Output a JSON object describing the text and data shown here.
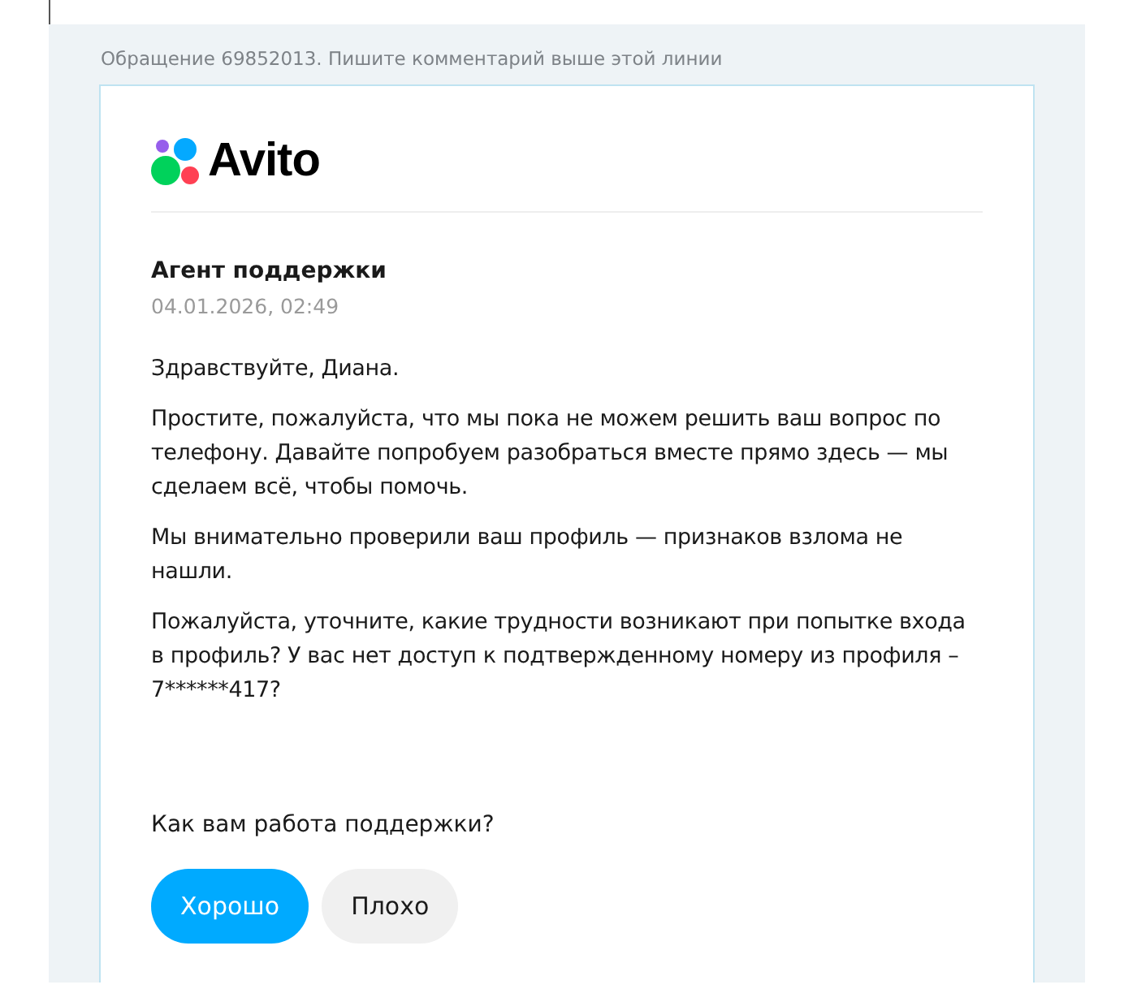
{
  "header_note": "Обращение 69852013. Пишите комментарий выше этой линии",
  "logo": {
    "text": "Avito"
  },
  "message": {
    "author": "Агент поддержки",
    "date": "04.01.2026, 02:49",
    "paragraphs": [
      "Здравствуйте, Диана.",
      "Простите, пожалуйста, что мы пока не можем решить ваш вопрос по телефону. Давайте попробуем разобраться вместе прямо здесь — мы сделаем всё, чтобы помочь.",
      "Мы внимательно проверили ваш профиль — признаков взлома не нашли.",
      "Пожалуйста, уточните, какие трудности возникают при попытке входа в профиль? У вас нет доступ к подтвержденному номеру из профиля – 7******417?"
    ]
  },
  "rating": {
    "question": "Как вам работа поддержки?",
    "buttons": [
      {
        "label": "Хорошо",
        "kind": "primary"
      },
      {
        "label": "Плохо",
        "kind": "secondary"
      }
    ]
  }
}
